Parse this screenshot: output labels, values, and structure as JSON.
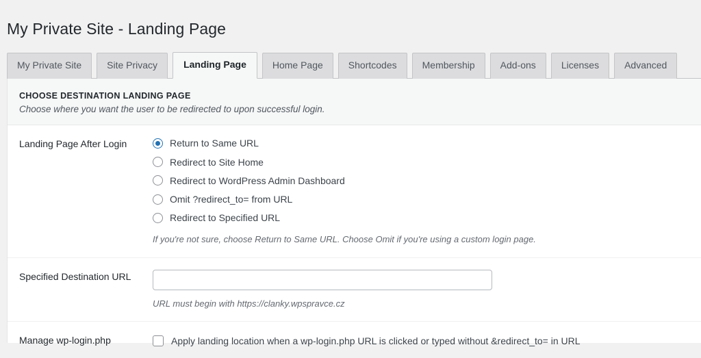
{
  "page": {
    "title": "My Private Site - Landing Page"
  },
  "tabs": [
    {
      "label": "My Private Site",
      "active": false
    },
    {
      "label": "Site Privacy",
      "active": false
    },
    {
      "label": "Landing Page",
      "active": true
    },
    {
      "label": "Home Page",
      "active": false
    },
    {
      "label": "Shortcodes",
      "active": false
    },
    {
      "label": "Membership",
      "active": false
    },
    {
      "label": "Add-ons",
      "active": false
    },
    {
      "label": "Licenses",
      "active": false
    },
    {
      "label": "Advanced",
      "active": false
    }
  ],
  "section": {
    "title": "CHOOSE DESTINATION LANDING PAGE",
    "description": "Choose where you want the user to be redirected to upon successful login."
  },
  "landing_page_row": {
    "label": "Landing Page After Login",
    "options": [
      {
        "label": "Return to Same URL",
        "selected": true
      },
      {
        "label": "Redirect to Site Home",
        "selected": false
      },
      {
        "label": "Redirect to WordPress Admin Dashboard",
        "selected": false
      },
      {
        "label": "Omit ?redirect_to= from URL",
        "selected": false
      },
      {
        "label": "Redirect to Specified URL",
        "selected": false
      }
    ],
    "hint": "If you're not sure, choose Return to Same URL. Choose Omit if you're using a custom login page."
  },
  "specified_url_row": {
    "label": "Specified Destination URL",
    "value": "",
    "placeholder": "",
    "hint": "URL must begin with https://clanky.wpspravce.cz"
  },
  "wp_login_row": {
    "label": "Manage wp-login.php",
    "checkbox_label": "Apply landing location when a wp-login.php URL is clicked or typed without &redirect_to= in URL",
    "checked": false
  },
  "colors": {
    "accent": "#2271b1",
    "page_background": "#f1f1f1",
    "panel_background": "#ffffff",
    "tab_inactive": "#dcdcde",
    "tab_active": "#f6f7f7",
    "border": "#c3c4c7",
    "text_primary": "#23282d",
    "text_muted": "#646970"
  }
}
